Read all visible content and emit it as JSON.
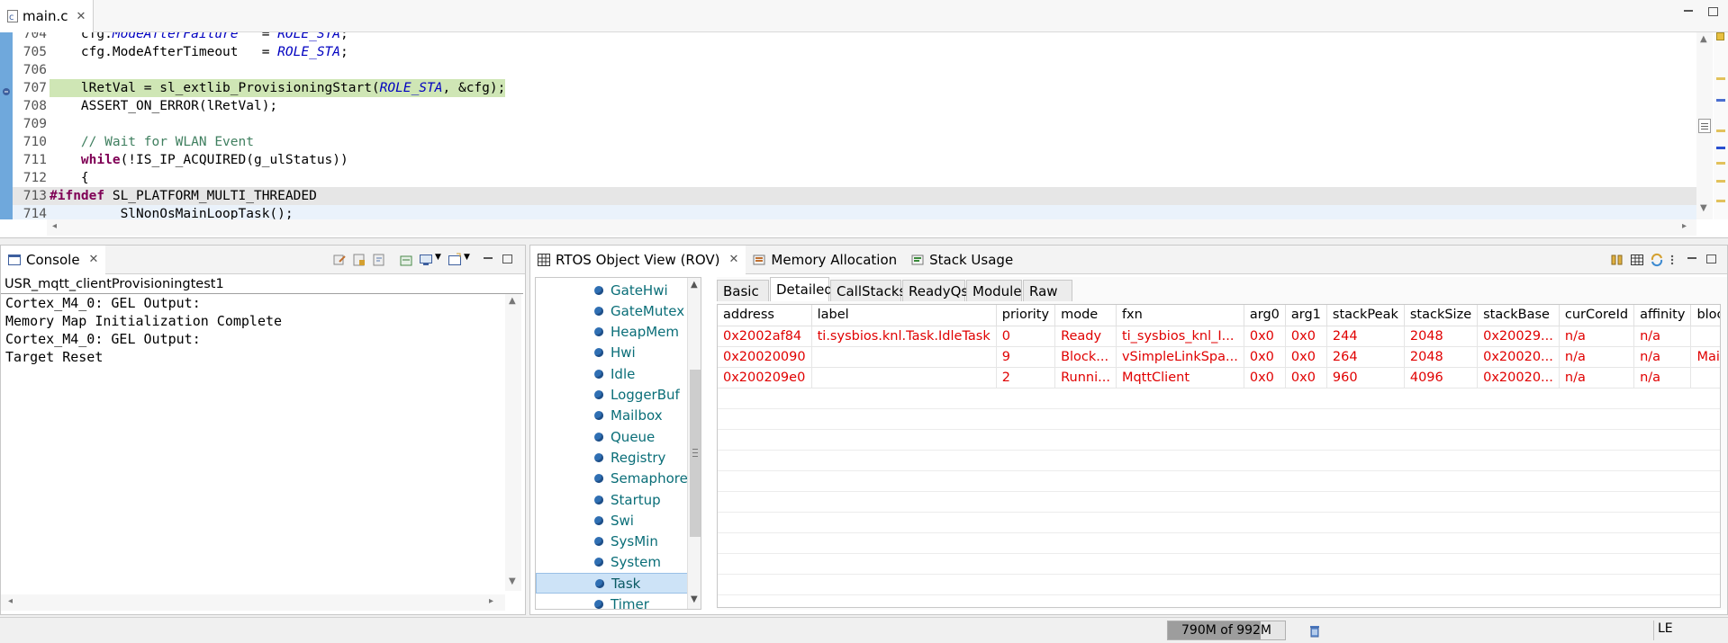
{
  "editor": {
    "tab_label": "main.c",
    "lines": [
      {
        "num": "704",
        "parts": [
          {
            "t": "    cfg.",
            "c": ""
          },
          {
            "t": "ModeAfterFailure",
            "c": "it"
          },
          {
            "t": "   = ",
            "c": ""
          },
          {
            "t": "ROLE_STA",
            "c": "it"
          },
          {
            "t": ";",
            "c": ""
          }
        ]
      },
      {
        "num": "705",
        "parts": [
          {
            "t": "    cfg.ModeAfterTimeout   = ",
            "c": ""
          },
          {
            "t": "ROLE_STA",
            "c": "it"
          },
          {
            "t": ";",
            "c": ""
          }
        ]
      },
      {
        "num": "706",
        "parts": [
          {
            "t": "",
            "c": ""
          }
        ]
      },
      {
        "num": "707",
        "hl": "green",
        "parts": [
          {
            "t": "    lRetVal = sl_extlib_ProvisioningStart(",
            "c": ""
          },
          {
            "t": "ROLE_STA",
            "c": "it"
          },
          {
            "t": ", &cfg);",
            "c": ""
          }
        ]
      },
      {
        "num": "708",
        "parts": [
          {
            "t": "    ASSERT_ON_ERROR(lRetVal);",
            "c": ""
          }
        ]
      },
      {
        "num": "709",
        "parts": [
          {
            "t": "",
            "c": ""
          }
        ]
      },
      {
        "num": "710",
        "parts": [
          {
            "t": "    ",
            "c": ""
          },
          {
            "t": "// Wait for WLAN Event",
            "c": "cm"
          }
        ]
      },
      {
        "num": "711",
        "parts": [
          {
            "t": "    ",
            "c": ""
          },
          {
            "t": "while",
            "c": "kw"
          },
          {
            "t": "(!IS_IP_ACQUIRED(g_ulStatus))",
            "c": ""
          }
        ]
      },
      {
        "num": "712",
        "parts": [
          {
            "t": "    {",
            "c": ""
          }
        ]
      },
      {
        "num": "713",
        "hl": "gray",
        "parts": [
          {
            "t": "#ifndef",
            "c": "kw"
          },
          {
            "t": " SL_PLATFORM_MULTI_THREADED",
            "c": ""
          }
        ]
      },
      {
        "num": "714",
        "hl": "blue",
        "parts": [
          {
            "t": "        _SlNonOsMainLoopTask();",
            "c": ""
          }
        ]
      }
    ]
  },
  "console": {
    "tab_label": "Console",
    "session": "USR_mqtt_clientProvisioningtest1",
    "output": "Cortex_M4_0: GEL Output:\nMemory Map Initialization Complete\nCortex_M4_0: GEL Output:\nTarget Reset"
  },
  "rov": {
    "tabs": [
      {
        "label": "RTOS Object View (ROV)",
        "active": true
      },
      {
        "label": "Memory Allocation",
        "active": false
      },
      {
        "label": "Stack Usage",
        "active": false
      }
    ],
    "tree": [
      "GateHwi",
      "GateMutex",
      "HeapMem",
      "Hwi",
      "Idle",
      "LoggerBuf",
      "Mailbox",
      "Queue",
      "Registry",
      "Semaphore",
      "Startup",
      "Swi",
      "SysMin",
      "System",
      "Task",
      "Timer"
    ],
    "selected": "Task",
    "subtabs": [
      "Basic",
      "Detailed",
      "CallStacks",
      "ReadyQs",
      "Module",
      "Raw"
    ],
    "active_subtab": "Detailed",
    "columns": [
      "address",
      "label",
      "priority",
      "mode",
      "fxn",
      "arg0",
      "arg1",
      "stackPeak",
      "stackSize",
      "stackBase",
      "curCoreId",
      "affinity",
      "blockedOn"
    ],
    "rows": [
      [
        "0x2002af84",
        "ti.sysbios.knl.Task.IdleTask",
        "0",
        "Ready",
        "ti_sysbios_knl_I...",
        "0x0",
        "0x0",
        "244",
        "2048",
        "0x20029...",
        "n/a",
        "n/a",
        ""
      ],
      [
        "0x20020090",
        "",
        "9",
        "Block...",
        "vSimpleLinkSpa...",
        "0x0",
        "0x0",
        "264",
        "2048",
        "0x20020...",
        "n/a",
        "n/a",
        "Mailbox_p..."
      ],
      [
        "0x200209e0",
        "",
        "2",
        "Runni...",
        "MqttClient",
        "0x0",
        "0x0",
        "960",
        "4096",
        "0x20020...",
        "n/a",
        "n/a",
        ""
      ]
    ]
  },
  "status": {
    "heap": "790M of 992M",
    "heap_fraction": 0.796,
    "endian": "LE"
  }
}
